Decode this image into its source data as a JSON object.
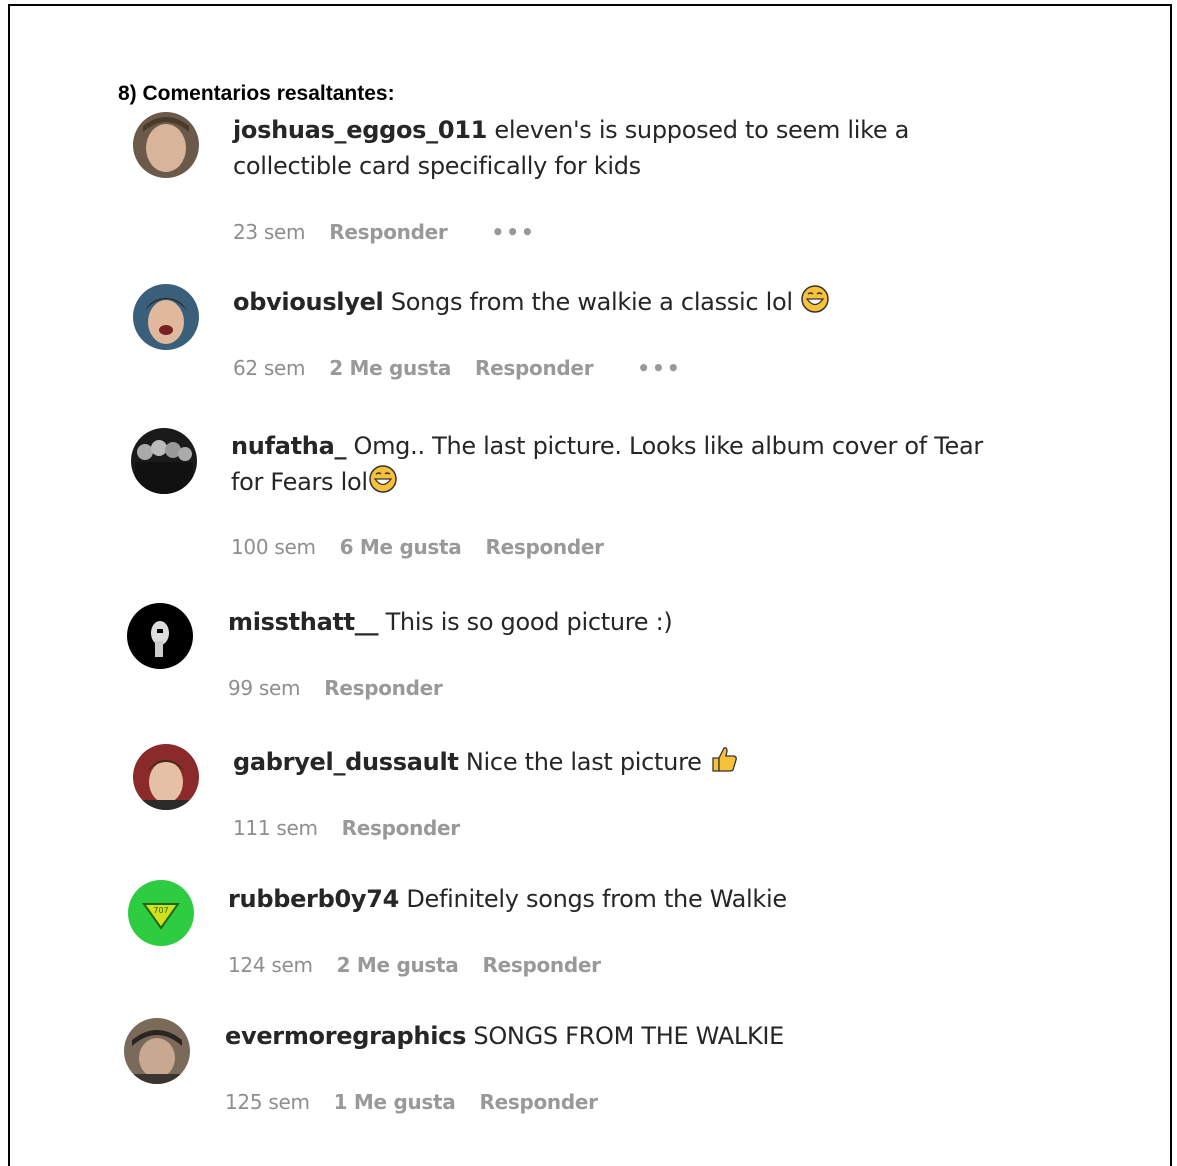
{
  "heading": "8) Comentarios resaltantes:",
  "comments": [
    {
      "username": "joshuas_eggos_011",
      "text": "eleven's is supposed to seem like a collectible card specifically for kids",
      "time": "23 sem",
      "likes": "",
      "reply": "Responder",
      "more": "•••"
    },
    {
      "username": "obviouslyel",
      "text": "Songs from the walkie a classic lol",
      "emoji": "grinning-sweat-emoji",
      "time": "62 sem",
      "likes": "2 Me gusta",
      "reply": "Responder",
      "more": "•••"
    },
    {
      "username": "nufatha_",
      "text": "Omg.. The last picture. Looks like album cover of Tear for Fears lol",
      "emoji": "grinning-sweat-emoji",
      "time": "100 sem",
      "likes": "6 Me gusta",
      "reply": "Responder",
      "more": ""
    },
    {
      "username": "missthatt__",
      "text": "This is so good picture :)",
      "time": "99 sem",
      "likes": "",
      "reply": "Responder",
      "more": ""
    },
    {
      "username": "gabryel_dussault",
      "text": "Nice the last picture",
      "emoji": "thumbs-up-emoji",
      "time": "111 sem",
      "likes": "",
      "reply": "Responder",
      "more": ""
    },
    {
      "username": "rubberb0y74",
      "text": "Definitely songs from the Walkie",
      "time": "124 sem",
      "likes": "2 Me gusta",
      "reply": "Responder",
      "more": ""
    },
    {
      "username": "evermoregraphics",
      "text": "SONGS FROM THE WALKIE",
      "time": "125 sem",
      "likes": "1 Me gusta",
      "reply": "Responder",
      "more": ""
    }
  ],
  "colors": {
    "text": "#262626",
    "meta": "#8e8e8e",
    "border": "#000000"
  }
}
